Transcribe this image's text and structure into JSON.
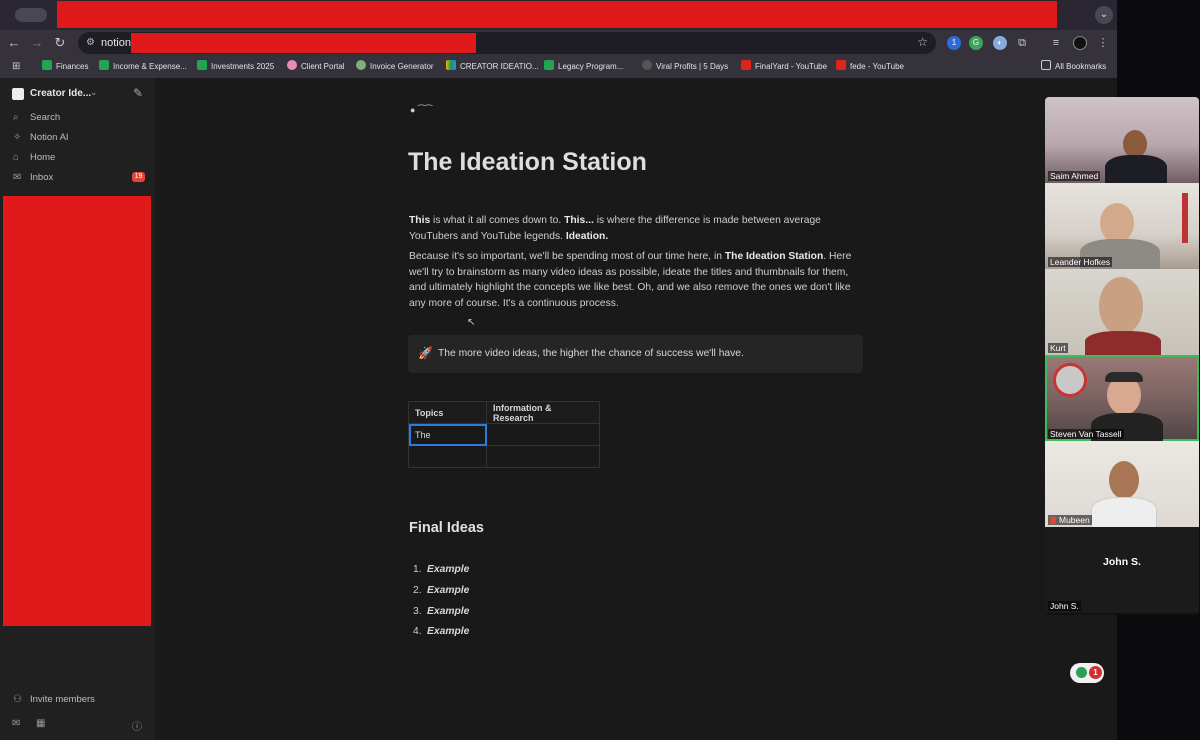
{
  "browser": {
    "url_prefix": "notion.",
    "bookmarks": [
      {
        "label": "Finances",
        "icon": "sheets-icon"
      },
      {
        "label": "Income & Expense...",
        "icon": "sheets-icon"
      },
      {
        "label": "Investments 2025",
        "icon": "sheets-icon"
      },
      {
        "label": "Client Portal",
        "icon": "brain-icon"
      },
      {
        "label": "Invoice Generator",
        "icon": "leaf-icon"
      },
      {
        "label": "CREATOR IDEATIO...",
        "icon": "drive-icon"
      },
      {
        "label": "Legacy Program...",
        "icon": "sheets-icon"
      },
      {
        "label": "Viral Profits | 5 Days",
        "icon": "globe-icon"
      },
      {
        "label": "FinalYard - YouTube",
        "icon": "youtube-icon"
      },
      {
        "label": "fede - YouTube",
        "icon": "youtube-icon"
      }
    ],
    "all_bookmarks": "All Bookmarks"
  },
  "sidebar": {
    "workspace": "Creator Ide...",
    "items": [
      {
        "label": "Search",
        "icon": "search-icon"
      },
      {
        "label": "Notion AI",
        "icon": "ai-icon"
      },
      {
        "label": "Home",
        "icon": "home-icon"
      },
      {
        "label": "Inbox",
        "icon": "inbox-icon",
        "badge": "19"
      }
    ],
    "invite": "Invite members"
  },
  "page": {
    "title": "The Ideation Station",
    "p1": {
      "b1": "This",
      "t1": " is what it all comes down to. ",
      "b2": "This...",
      "t2": " is where the difference is made between average YouTubers and YouTube legends. ",
      "b3": "Ideation."
    },
    "p2": {
      "t1": "Because it's so important, we'll be spending most of our time here, in ",
      "b1": "The Ideation Station",
      "t2": ". Here we'll try to brainstorm as many video ideas as possible, ideate the titles and thumbnails for them, and ultimately highlight the concepts we like best. Oh, and we also remove the ones we don't like any more of course. It's a continuous process."
    },
    "callout": {
      "icon": "🚀",
      "text": "The more video ideas, the higher the chance of success we'll have."
    },
    "table": {
      "headers": [
        "Topics",
        "Information & Research"
      ],
      "rows": [
        [
          "The",
          ""
        ],
        [
          "",
          ""
        ]
      ]
    },
    "final_ideas_heading": "Final Ideas",
    "final_ideas": [
      {
        "num": "1.",
        "text": "Example"
      },
      {
        "num": "2.",
        "text": "Example"
      },
      {
        "num": "3.",
        "text": "Example"
      },
      {
        "num": "4.",
        "text": "Example"
      }
    ],
    "help_count": "1"
  },
  "video_call": {
    "participants": [
      {
        "name": "Saim Ahmed"
      },
      {
        "name": "Leander Hofkes"
      },
      {
        "name": "Kurt"
      },
      {
        "name": "Steven Van Tassell",
        "active": true
      },
      {
        "name": "Mubeen",
        "muted": true
      },
      {
        "name": "John S.",
        "camera_off": true
      }
    ]
  }
}
